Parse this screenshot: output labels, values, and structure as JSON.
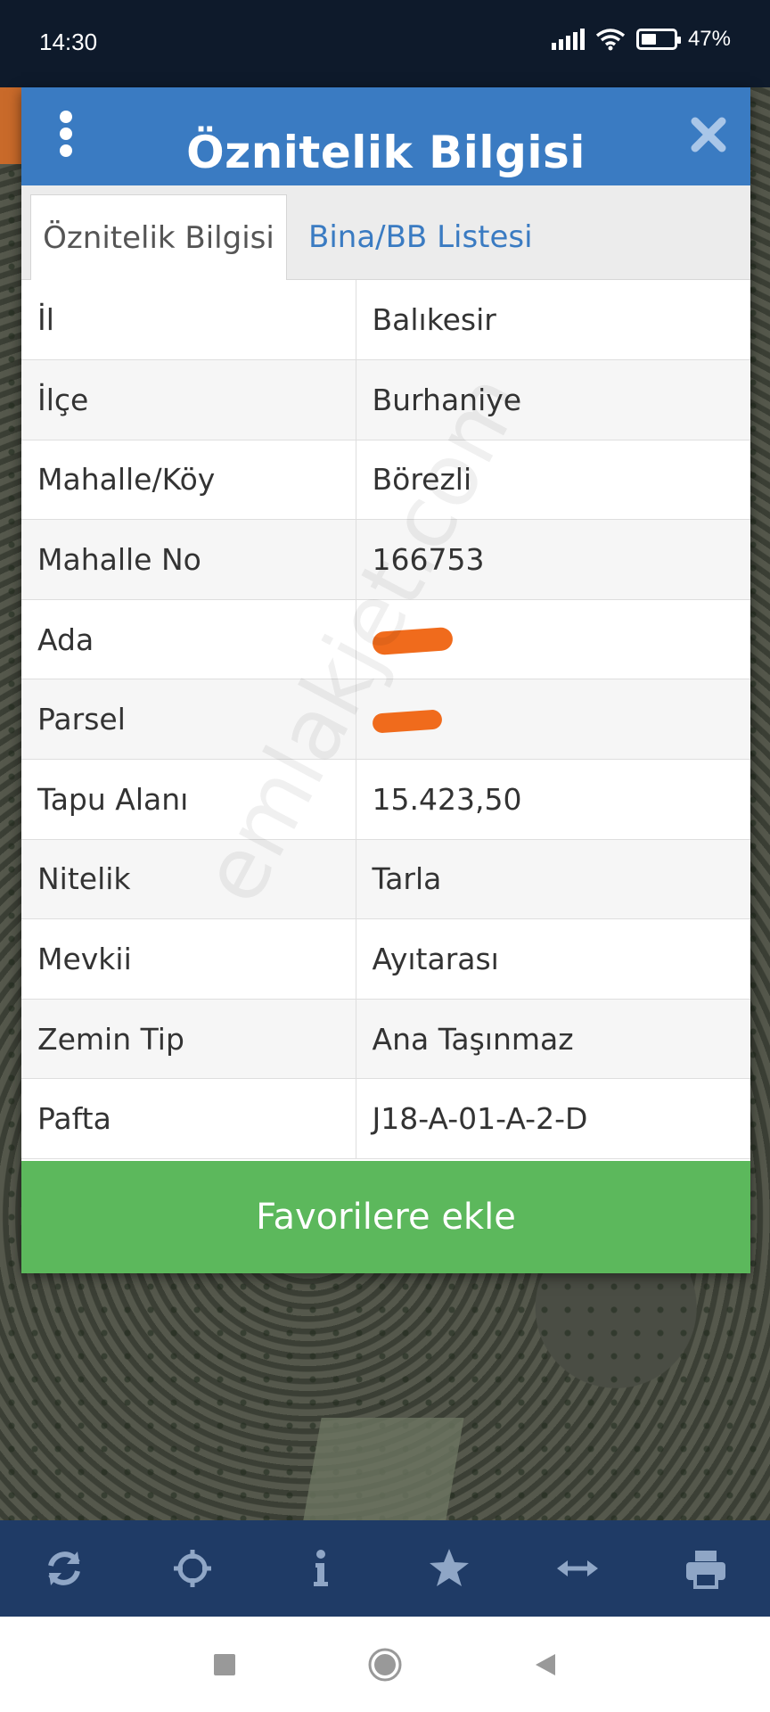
{
  "status_bar": {
    "time": "14:30",
    "battery": "47%",
    "battery_level": 0.47
  },
  "dialog": {
    "title": "Öznitelik Bilgisi",
    "tabs": [
      {
        "label": "Öznitelik Bilgisi",
        "active": true
      },
      {
        "label": "Bina/BB Listesi",
        "active": false
      }
    ],
    "rows": [
      {
        "key": "İl",
        "value": "Balıkesir"
      },
      {
        "key": "İlçe",
        "value": "Burhaniye"
      },
      {
        "key": "Mahalle/Köy",
        "value": "Börezli"
      },
      {
        "key": "Mahalle No",
        "value": "166753"
      },
      {
        "key": "Ada",
        "value": "",
        "redacted": true
      },
      {
        "key": "Parsel",
        "value": "",
        "redacted": true
      },
      {
        "key": "Tapu Alanı",
        "value": "15.423,50"
      },
      {
        "key": "Nitelik",
        "value": "Tarla"
      },
      {
        "key": "Mevkii",
        "value": "Ayıtarası"
      },
      {
        "key": "Zemin Tip",
        "value": "Ana Taşınmaz"
      },
      {
        "key": "Pafta",
        "value": "J18-A-01-A-2-D"
      }
    ],
    "favorite_button": "Favorilere ekle",
    "watermark": "emlakjet.com"
  },
  "toolbar": {
    "icons": [
      "refresh-icon",
      "crosshair-icon",
      "info-icon",
      "star-icon",
      "arrows-horizontal-icon",
      "printer-icon"
    ]
  },
  "colors": {
    "header": "#3a7bc2",
    "favorite": "#5cb85c",
    "toolbar": "#1f3b66",
    "redaction": "#f06b1c"
  }
}
